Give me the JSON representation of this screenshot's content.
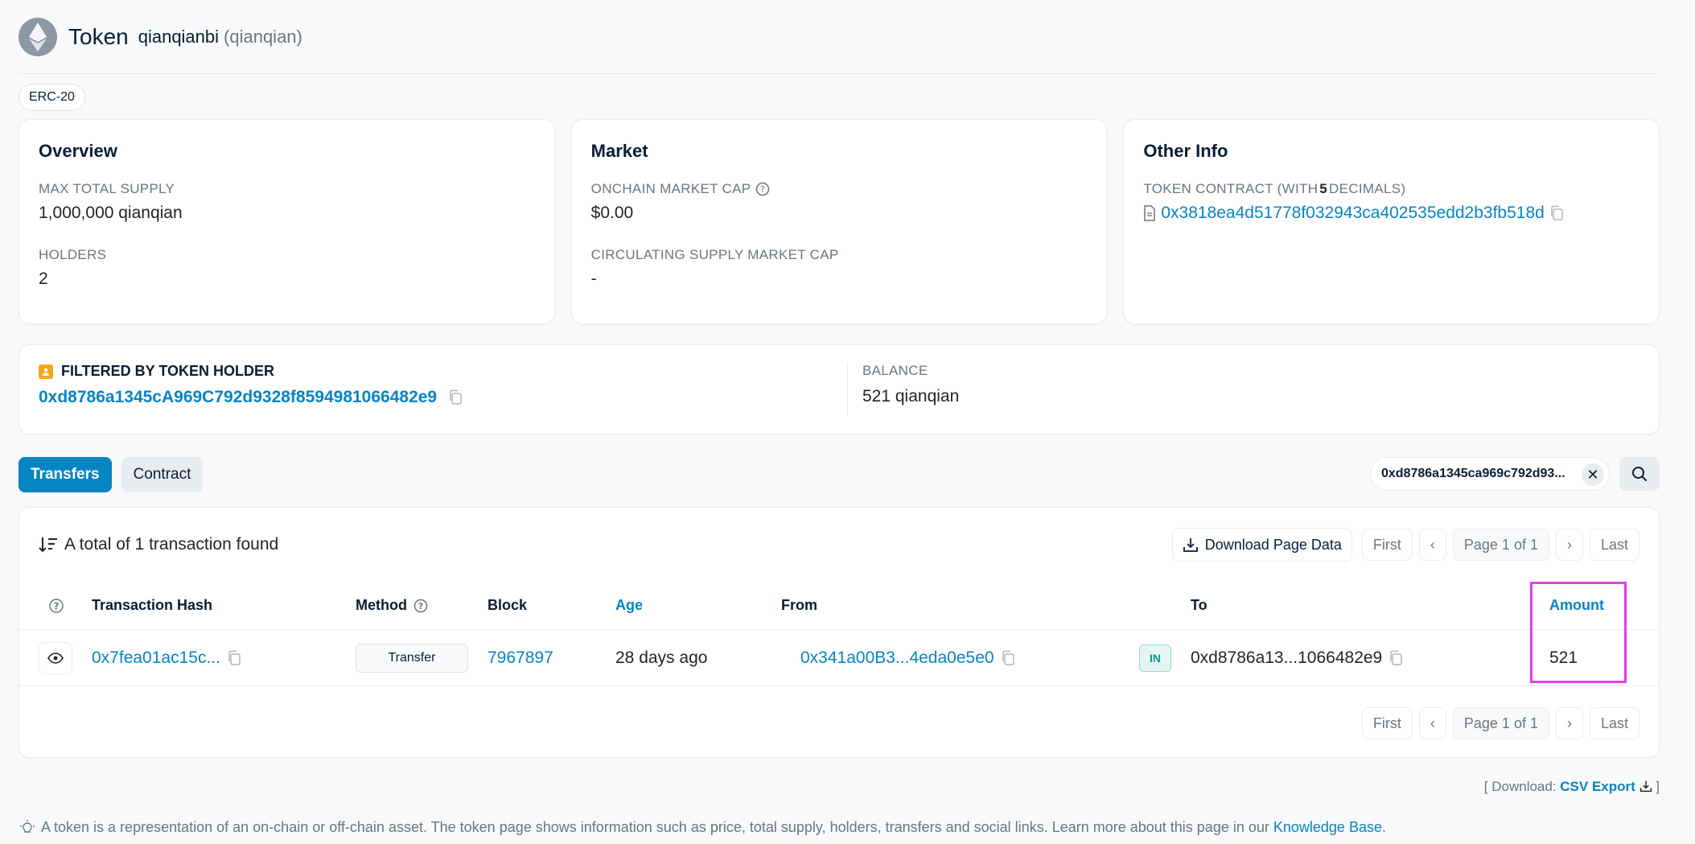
{
  "header": {
    "title": "Token",
    "token_name": "qianqianbi",
    "token_symbol": "(qianqian)",
    "standard_badge": "ERC-20"
  },
  "overview": {
    "heading": "Overview",
    "max_supply_label": "MAX TOTAL SUPPLY",
    "max_supply_value": "1,000,000 qianqian",
    "holders_label": "HOLDERS",
    "holders_value": "2"
  },
  "market": {
    "heading": "Market",
    "onchain_cap_label": "ONCHAIN MARKET CAP",
    "onchain_cap_value": "$0.00",
    "circ_cap_label": "CIRCULATING SUPPLY MARKET CAP",
    "circ_cap_value": "-"
  },
  "other_info": {
    "heading": "Other Info",
    "contract_label_prefix": "TOKEN CONTRACT (WITH ",
    "contract_decimals": "5",
    "contract_label_suffix": " DECIMALS)",
    "contract_address": "0x3818ea4d51778f032943ca402535edd2b3fb518d"
  },
  "filter": {
    "title": "FILTERED BY TOKEN HOLDER",
    "address": "0xd8786a1345cA969C792d9328f8594981066482e9",
    "balance_label": "BALANCE",
    "balance_value": "521 qianqian"
  },
  "tabs": {
    "transfers": "Transfers",
    "contract": "Contract"
  },
  "search_chip": {
    "value": "0xd8786a1345ca969c792d93..."
  },
  "table": {
    "total_text": "A total of 1 transaction found",
    "download_label": "Download Page Data",
    "pager": {
      "first": "First",
      "page": "Page 1 of 1",
      "last": "Last"
    },
    "headers": {
      "hash": "Transaction Hash",
      "method": "Method",
      "block": "Block",
      "age": "Age",
      "from": "From",
      "to": "To",
      "amount": "Amount"
    },
    "rows": [
      {
        "hash": "0x7fea01ac15c...",
        "method": "Transfer",
        "block": "7967897",
        "age": "28 days ago",
        "from": "0x341a00B3...4eda0e5e0",
        "direction": "IN",
        "to": "0xd8786a13...1066482e9",
        "amount": "521"
      }
    ]
  },
  "footer": {
    "download_prefix": "[ Download: ",
    "csv_label": "CSV Export",
    "download_suffix": " ]",
    "note_text": "A token is a representation of an on-chain or off-chain asset. The token page shows information such as price, total supply, holders, transfers and social links. Learn more about this page in our ",
    "kb_link": "Knowledge Base",
    "note_end": "."
  },
  "colors": {
    "accent": "#0784c3",
    "highlight": "#e040e8",
    "in_badge": "#00a186",
    "holder_icon": "#f3a71f"
  }
}
